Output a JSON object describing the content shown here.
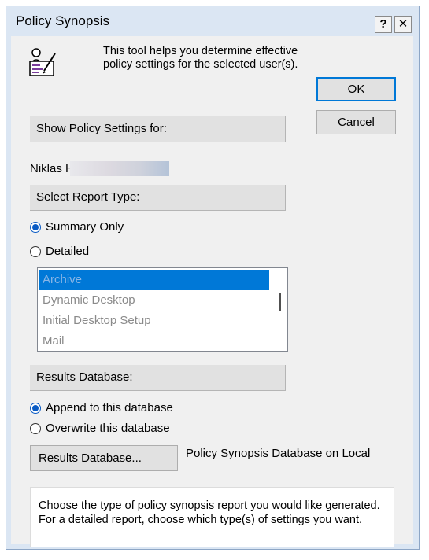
{
  "window": {
    "title": "Policy Synopsis",
    "help_button": "?",
    "close_button": "✕"
  },
  "intro": {
    "text": "This tool helps you determine effective policy settings for the  selected user(s).",
    "icon": "policy-tool-icon"
  },
  "buttons": {
    "ok": "OK",
    "cancel": "Cancel",
    "results_database": "Results Database..."
  },
  "show_policy": {
    "header": "Show Policy Settings for:",
    "user_name": "Niklas H"
  },
  "report_type": {
    "header": "Select Report Type:",
    "options": [
      {
        "label": "Summary Only",
        "checked": true
      },
      {
        "label": "Detailed",
        "checked": false
      }
    ],
    "list_items": [
      {
        "label": "Archive",
        "selected": true
      },
      {
        "label": "Dynamic Desktop",
        "selected": false
      },
      {
        "label": "Initial Desktop Setup",
        "selected": false
      },
      {
        "label": "Mail",
        "selected": false
      }
    ]
  },
  "results_db": {
    "header": "Results Database:",
    "options": [
      {
        "label": "Append to this database",
        "checked": true
      },
      {
        "label": "Overwrite this database",
        "checked": false
      }
    ],
    "database_label": "Policy Synopsis Database on Local"
  },
  "help_text": "Choose the type of policy synopsis report you would like generated.  For a detailed report, choose which type(s) of settings you want.",
  "colors": {
    "frame": "#dbe6f3",
    "client": "#f0f0f0",
    "accent": "#0078d7"
  }
}
